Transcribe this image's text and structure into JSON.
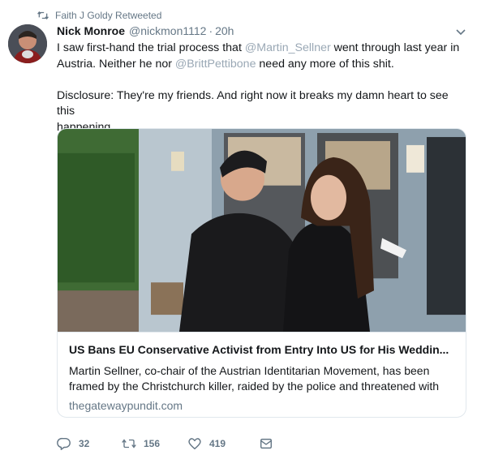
{
  "retweet_header": {
    "text": "Faith J Goldy Retweeted"
  },
  "author": {
    "name": "Nick Monroe",
    "handle": "@nickmon1112",
    "separator": "·",
    "time": "20h"
  },
  "tweet": {
    "line1_a": "I saw first-hand the trial process that ",
    "mention1": "@Martin_Sellner",
    "line1_b": " went through last year in",
    "line2_a": "Austria. Neither he nor ",
    "mention2": "@BrittPettibone",
    "line2_b": " need any more of this shit.",
    "line3": "Disclosure: They're my friends. And right now it breaks my damn heart to see this",
    "line4": "happening."
  },
  "card": {
    "title": "US Bans EU Conservative Activist from Entry Into US for His Weddin...",
    "description_line1": "Martin Sellner, co-chair of the Austrian Identitarian Movement, has been",
    "description_line2": "framed by the Christchurch killer, raided by the police  and threatened with",
    "domain": "thegatewaypundit.com"
  },
  "actions": {
    "replies": "32",
    "retweets": "156",
    "likes": "419"
  },
  "colors": {
    "text": "#14171a",
    "secondary": "#657786",
    "mention": "#9aa8b5",
    "border": "#e1e8ed"
  },
  "icons": [
    "retweet-icon",
    "chevron-down-icon",
    "reply-icon",
    "retweet-icon",
    "heart-icon",
    "envelope-icon"
  ]
}
